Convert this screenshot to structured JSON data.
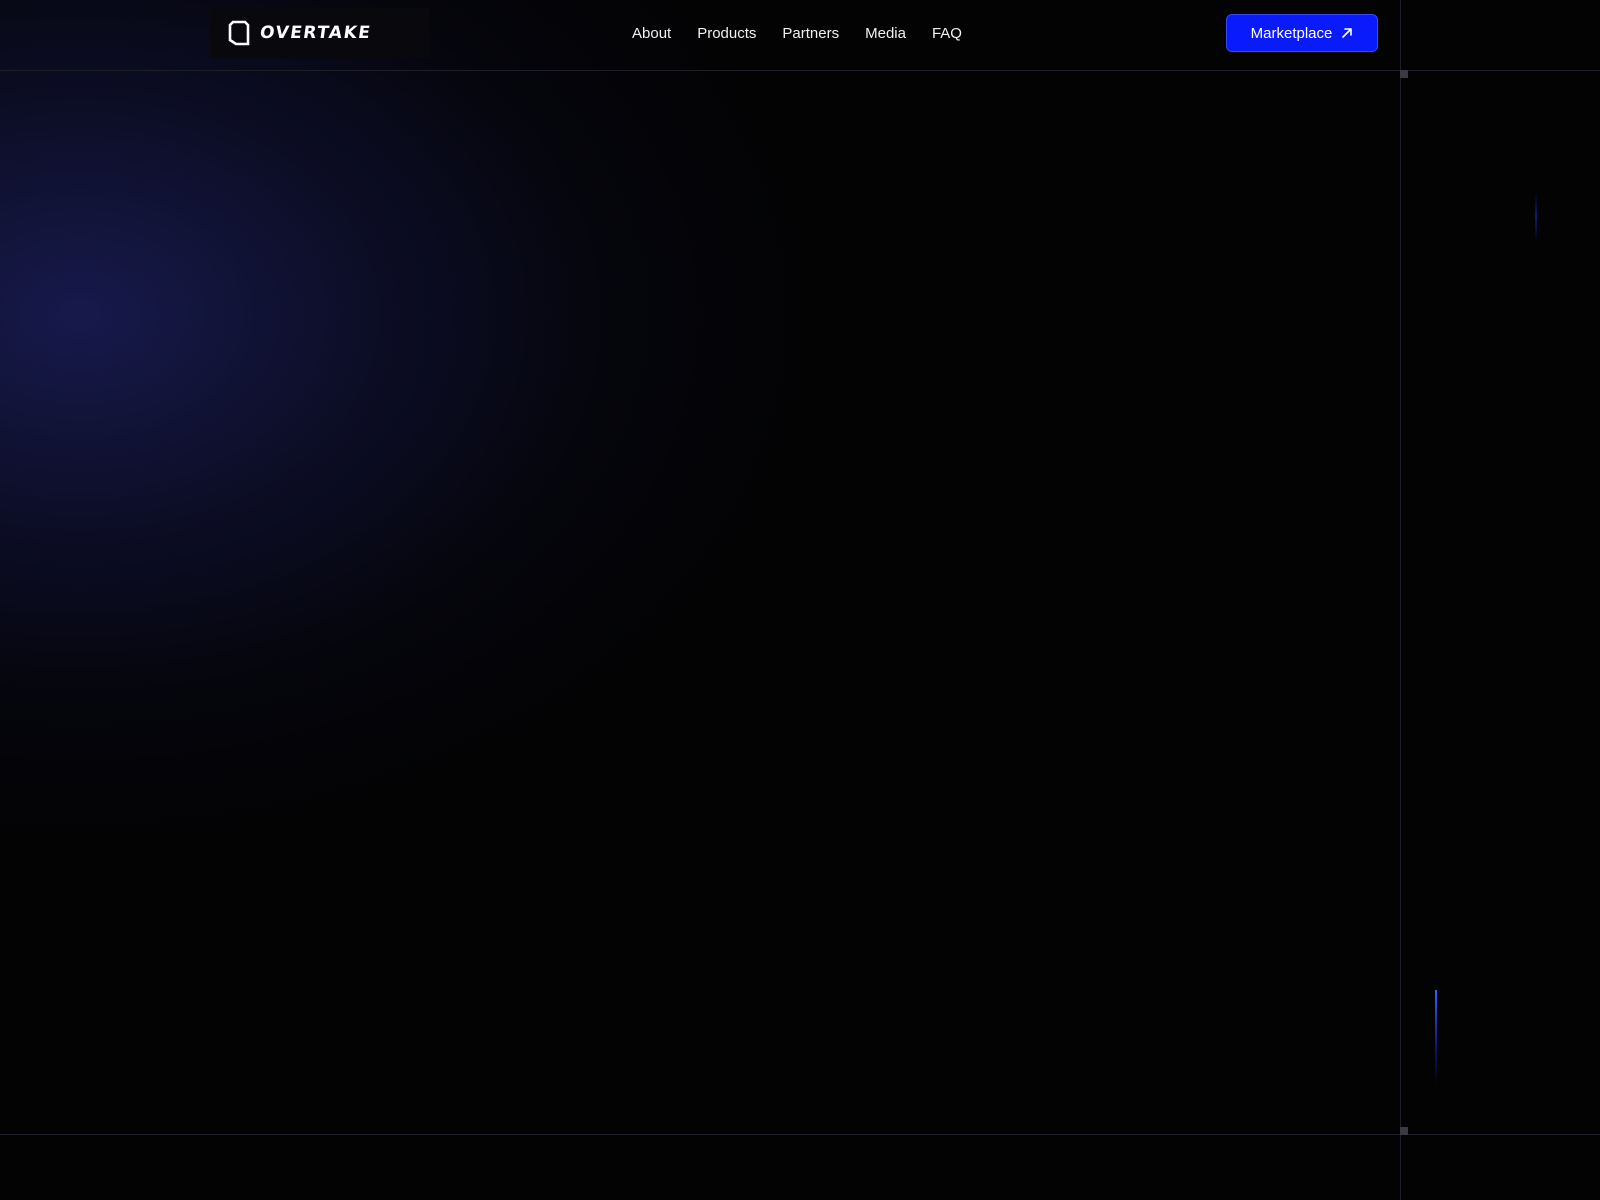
{
  "brand": {
    "name": "OVERTAKE"
  },
  "nav": {
    "items": [
      {
        "label": "About"
      },
      {
        "label": "Products"
      },
      {
        "label": "Partners"
      },
      {
        "label": "Media"
      },
      {
        "label": "FAQ"
      }
    ]
  },
  "cta": {
    "label": "Marketplace",
    "icon": "arrow-up-right-icon",
    "color": "#0a1bfb"
  },
  "theme": {
    "background": "#030304",
    "glow": "#1a1e58",
    "accent": "#3f5cff"
  }
}
